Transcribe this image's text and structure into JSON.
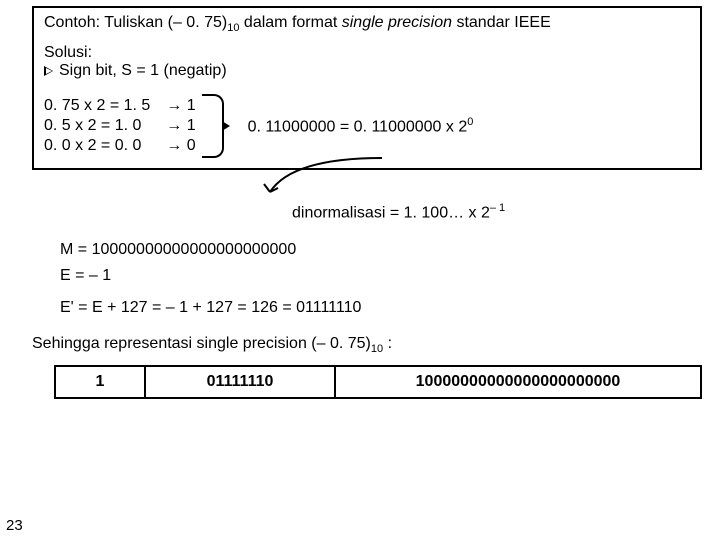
{
  "title_prefix": "Contoh: Tuliskan (– 0. 75)",
  "title_sub": "10",
  "title_mid": " dalam format ",
  "title_italic": "single precision",
  "title_suffix": " standar IEEE",
  "solusi_label": "Solusi:",
  "sign_bit_text": "Sign bit, S = 1 (negatip)",
  "calc": {
    "left": [
      "0. 75 x 2 = 1. 5",
      "0. 5 x 2 = 1. 0",
      "0. 0 x 2 = 0. 0"
    ],
    "right": [
      "→ 1",
      "→ 1",
      "→ 0"
    ]
  },
  "result_pre": "0. 11000000 = 0. 11000000 x 2",
  "result_exp": "0",
  "normal_pre": "dinormalisasi = 1. 100… x 2",
  "normal_exp": "– 1",
  "m_line": "M = 10000000000000000000000",
  "e_line": "E = – 1",
  "eprime_line": "E' = E + 127 = – 1 + 127 = 126 = 01111110",
  "sehingga_pre": "Sehingga representasi single precision (– 0. 75)",
  "sehingga_sub": "10",
  "sehingga_suffix": "  :",
  "table": {
    "s": "1",
    "e": "01111110",
    "m": "10000000000000000000000"
  },
  "page_number": "23"
}
